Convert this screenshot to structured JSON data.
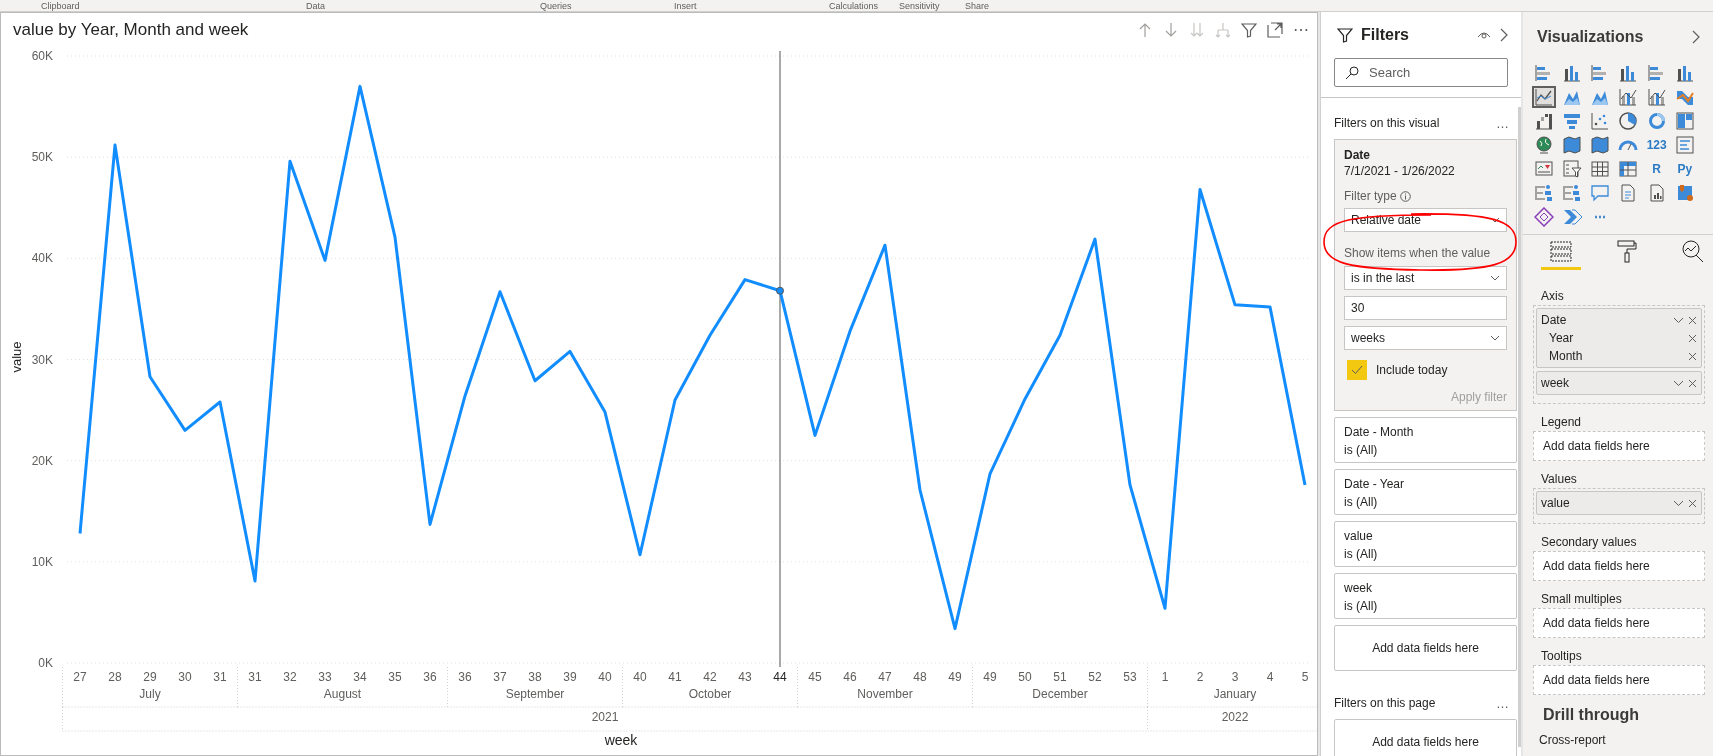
{
  "ribbon_groups": [
    "Clipboard",
    "Data",
    "Queries",
    "Insert",
    "Calculations",
    "Sensitivity",
    "Share"
  ],
  "visual": {
    "header_icons": [
      {
        "kind": "drill-up"
      },
      {
        "kind": "drill-down"
      },
      {
        "kind": "next-level"
      },
      {
        "kind": "expand"
      },
      {
        "kind": "filter"
      },
      {
        "kind": "focus"
      },
      {
        "kind": "more",
        "text": "⋯"
      }
    ],
    "x_axis": {
      "years": [
        {
          "label": "2021",
          "months": [
            {
              "label": "July",
              "weeks": [
                {
                  "label": "27",
                  "hovered": false
                },
                {
                  "label": "28",
                  "hovered": false
                },
                {
                  "label": "29",
                  "hovered": false
                },
                {
                  "label": "30",
                  "hovered": false
                },
                {
                  "label": "31",
                  "hovered": false
                }
              ]
            },
            {
              "label": "August",
              "weeks": [
                {
                  "label": "31",
                  "hovered": false
                },
                {
                  "label": "32",
                  "hovered": false
                },
                {
                  "label": "33",
                  "hovered": false
                },
                {
                  "label": "34",
                  "hovered": false
                },
                {
                  "label": "35",
                  "hovered": false
                },
                {
                  "label": "36",
                  "hovered": false
                }
              ]
            },
            {
              "label": "September",
              "weeks": [
                {
                  "label": "36",
                  "hovered": false
                },
                {
                  "label": "37",
                  "hovered": false
                },
                {
                  "label": "38",
                  "hovered": false
                },
                {
                  "label": "39",
                  "hovered": false
                },
                {
                  "label": "40",
                  "hovered": false
                }
              ]
            },
            {
              "label": "October",
              "weeks": [
                {
                  "label": "40",
                  "hovered": false
                },
                {
                  "label": "41",
                  "hovered": false
                },
                {
                  "label": "42",
                  "hovered": false
                },
                {
                  "label": "43",
                  "hovered": false
                },
                {
                  "label": "44",
                  "hovered": true
                }
              ]
            },
            {
              "label": "November",
              "weeks": [
                {
                  "label": "45",
                  "hovered": false
                },
                {
                  "label": "46",
                  "hovered": false
                },
                {
                  "label": "47",
                  "hovered": false
                },
                {
                  "label": "48",
                  "hovered": false
                },
                {
                  "label": "49",
                  "hovered": false
                }
              ]
            },
            {
              "label": "December",
              "weeks": [
                {
                  "label": "49",
                  "hovered": false
                },
                {
                  "label": "50",
                  "hovered": false
                },
                {
                  "label": "51",
                  "hovered": false
                },
                {
                  "label": "52",
                  "hovered": false
                },
                {
                  "label": "53",
                  "hovered": false
                }
              ]
            }
          ]
        },
        {
          "label": "2022",
          "months": [
            {
              "label": "January",
              "weeks": [
                {
                  "label": "1",
                  "hovered": false
                },
                {
                  "label": "2",
                  "hovered": false
                },
                {
                  "label": "3",
                  "hovered": false
                },
                {
                  "label": "4",
                  "hovered": false
                },
                {
                  "label": "5",
                  "hovered": false
                }
              ]
            }
          ]
        }
      ]
    },
    "chart_data": {
      "type": "line",
      "title": "value by Year, Month and week",
      "xlabel": "week",
      "ylabel": "value",
      "ylim": [
        0,
        60000
      ],
      "grid": true,
      "yticks": [
        {
          "value": 0,
          "label": "0K"
        },
        {
          "value": 10000,
          "label": "10K"
        },
        {
          "value": 20000,
          "label": "20K"
        },
        {
          "value": 30000,
          "label": "30K"
        },
        {
          "value": 40000,
          "label": "40K"
        },
        {
          "value": 50000,
          "label": "50K"
        },
        {
          "value": 60000,
          "label": "60K"
        }
      ],
      "series": [
        {
          "color": "#118dff",
          "values": [
            12800,
            51200,
            28300,
            23000,
            25800,
            8100,
            49600,
            39800,
            57000,
            42100,
            13700,
            26400,
            36700,
            27900,
            30800,
            24800,
            10700,
            26000,
            32400,
            37900,
            36800,
            22500,
            32800,
            41300,
            17100,
            3400,
            18700,
            26100,
            32400,
            41900,
            17600,
            5400,
            46800,
            35400,
            35200,
            17600
          ]
        }
      ]
    }
  },
  "filters": {
    "title": "Filters",
    "search": {
      "placeholder": "Search"
    },
    "visual_section": {
      "title": "Filters on this visual",
      "more": "…"
    },
    "date_card": {
      "title": "Date",
      "range": "7/1/2021 - 1/26/2022",
      "filter_type_label": "Filter type",
      "filter_type": "Relative date",
      "condition_label": "Show items when the value",
      "operator": "is in the last",
      "amount": "30",
      "unit": "weeks",
      "include_today": {
        "label": "Include today",
        "checked": true
      },
      "apply": {
        "label": "Apply filter",
        "disabled": true
      }
    },
    "cards": [
      {
        "title": "Date - Month",
        "state": "is (All)"
      },
      {
        "title": "Date - Year",
        "state": "is (All)"
      },
      {
        "title": "value",
        "state": "is (All)"
      },
      {
        "title": "week",
        "state": "is (All)"
      }
    ],
    "visual_add": "Add data fields here",
    "page_section": {
      "title": "Filters on this page",
      "more": "…"
    },
    "page_add": "Add data fields here"
  },
  "visualizations": {
    "title": "Visualizations",
    "icons": [
      {
        "kind": "hbar",
        "selected": false
      },
      {
        "kind": "vbar",
        "selected": false
      },
      {
        "kind": "hbar",
        "selected": false
      },
      {
        "kind": "vbar",
        "selected": false
      },
      {
        "kind": "hbar",
        "selected": false
      },
      {
        "kind": "vbar",
        "selected": false
      },
      {
        "kind": "line",
        "selected": true
      },
      {
        "kind": "area",
        "selected": false
      },
      {
        "kind": "area",
        "selected": false
      },
      {
        "kind": "combo",
        "selected": false
      },
      {
        "kind": "combo",
        "selected": false
      },
      {
        "kind": "ribbon",
        "selected": false
      },
      {
        "kind": "waterfall",
        "selected": false
      },
      {
        "kind": "funnel",
        "selected": false
      },
      {
        "kind": "scatter",
        "selected": false
      },
      {
        "kind": "pie",
        "selected": false
      },
      {
        "kind": "donut",
        "selected": false
      },
      {
        "kind": "treemap",
        "selected": false
      },
      {
        "kind": "globe",
        "selected": false
      },
      {
        "kind": "map",
        "selected": false
      },
      {
        "kind": "map",
        "selected": false
      },
      {
        "kind": "gauge",
        "selected": false
      },
      {
        "kind": "text",
        "text": "123",
        "selected": false
      },
      {
        "kind": "list",
        "selected": false
      },
      {
        "kind": "kpi",
        "selected": false
      },
      {
        "kind": "slicer",
        "selected": false
      },
      {
        "kind": "table",
        "selected": false
      },
      {
        "kind": "matrix",
        "selected": false
      },
      {
        "kind": "text",
        "text": "R",
        "selected": false
      },
      {
        "kind": "text",
        "text": "Py",
        "selected": false
      },
      {
        "kind": "tree",
        "selected": false
      },
      {
        "kind": "tree",
        "selected": false
      },
      {
        "kind": "bubble",
        "selected": false
      },
      {
        "kind": "document",
        "selected": false
      },
      {
        "kind": "report",
        "selected": false
      },
      {
        "kind": "pin",
        "selected": false
      },
      {
        "kind": "diamond",
        "selected": false
      },
      {
        "kind": "chevrons",
        "selected": false
      },
      {
        "kind": "text",
        "text": "⋯",
        "selected": false
      }
    ],
    "tabs": [
      {
        "kind": "fields",
        "selected": true
      },
      {
        "kind": "format",
        "selected": false
      },
      {
        "kind": "analytics",
        "selected": false
      }
    ],
    "wells": [
      {
        "label": "Axis",
        "fields": [
          {
            "name": "Date",
            "children": [
              {
                "name": "Year"
              },
              {
                "name": "Month"
              }
            ]
          },
          {
            "name": "week"
          }
        ]
      },
      {
        "label": "Legend",
        "placeholder": "Add data fields here"
      },
      {
        "label": "Values",
        "fields": [
          {
            "name": "value"
          }
        ]
      },
      {
        "label": "Secondary values",
        "placeholder": "Add data fields here"
      },
      {
        "label": "Small multiples",
        "placeholder": "Add data fields here"
      },
      {
        "label": "Tooltips",
        "placeholder": "Add data fields here"
      }
    ],
    "drill_through": {
      "title": "Drill through",
      "cross_report": "Cross-report"
    }
  },
  "annotation": {
    "kind": "ellipse",
    "color": "#ff0000"
  }
}
